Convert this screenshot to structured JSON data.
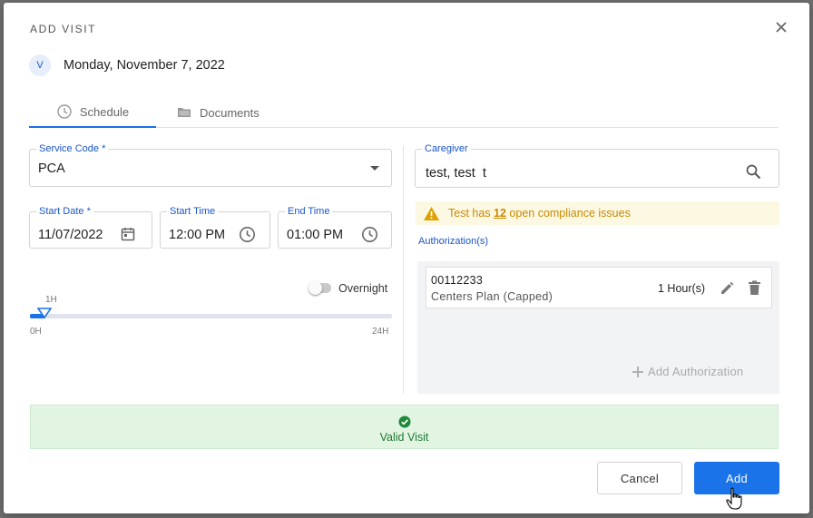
{
  "modal": {
    "title": "ADD VISIT",
    "avatar_initial": "V",
    "date": "Monday, November 7, 2022"
  },
  "tabs": [
    {
      "label": "Schedule",
      "icon": "clock-icon",
      "active": true
    },
    {
      "label": "Documents",
      "icon": "folder-icon",
      "active": false
    }
  ],
  "form": {
    "service_code": {
      "label": "Service Code *",
      "value": "PCA"
    },
    "start_date": {
      "label": "Start Date *",
      "value": "11/07/2022"
    },
    "start_time": {
      "label": "Start Time",
      "value": "12:00 PM"
    },
    "end_time": {
      "label": "End Time",
      "value": "01:00 PM"
    },
    "caregiver": {
      "label": "Caregiver",
      "value": "test, test  t"
    }
  },
  "overnight": {
    "label": "Overnight",
    "on": false
  },
  "duration_slider": {
    "value_label": "1H",
    "min_label": "0H",
    "max_label": "24H",
    "value_hours": 1,
    "max_hours": 24
  },
  "compliance_warning": {
    "prefix": "Test has ",
    "count": "12",
    "suffix": " open compliance issues",
    "color": "#c98a00"
  },
  "authorizations": {
    "title": "Authorization(s)",
    "items": [
      {
        "code": "00112233",
        "plan": "Centers Plan (Capped)",
        "hours": "1 Hour(s)"
      }
    ],
    "add_label": "Add Authorization"
  },
  "status": {
    "label": "Valid Visit",
    "color": "#1f7a33"
  },
  "actions": {
    "cancel_label": "Cancel",
    "add_label": "Add"
  },
  "colors": {
    "accent": "#1a73e8",
    "success_bg": "#e2f5e3",
    "warning_bg": "#fdf8e1"
  }
}
